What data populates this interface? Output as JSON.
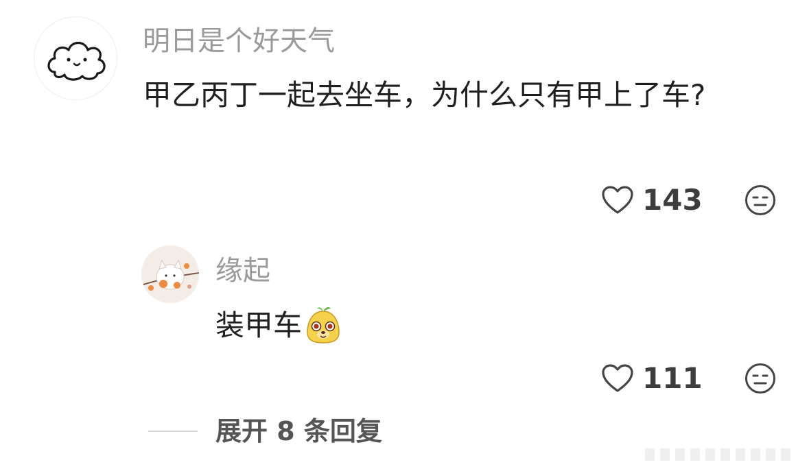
{
  "comment": {
    "username": "明日是个好天气",
    "text": "甲乙丙丁一起去坐车，为什么只有甲上了车?",
    "likes": "143",
    "avatar_icon": "cloud-face-icon",
    "like_icon": "heart-outline-icon",
    "dislike_icon": "meh-face-icon"
  },
  "reply": {
    "username": "缘起",
    "text": "装甲车",
    "emoji_icon": "cute-dog-emoji-icon",
    "likes": "111",
    "avatar_icon": "cat-illustration-avatar",
    "like_icon": "heart-outline-icon",
    "dislike_icon": "meh-face-icon"
  },
  "expand": {
    "label": "展开 8 条回复"
  },
  "colors": {
    "username": "#9a9a9a",
    "text": "#1f1f1f",
    "icon": "#444444"
  }
}
